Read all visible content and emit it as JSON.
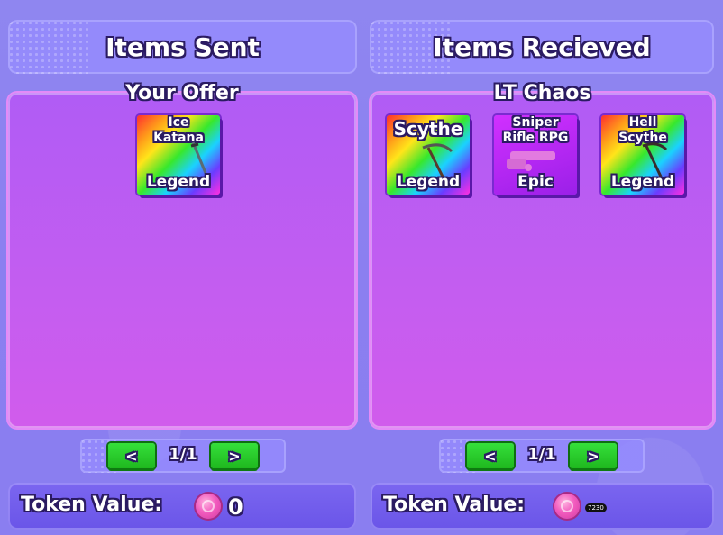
{
  "sent": {
    "header": "Items Sent",
    "box_title": "Your Offer",
    "items": [
      {
        "name": "Ice Katana",
        "rarity": "Legend",
        "icon": "katana-icon"
      }
    ],
    "pager": {
      "prev": "<",
      "next": ">",
      "count": "1/1"
    },
    "token": {
      "label": "Token Value:",
      "value": "0",
      "icon": "token-coin-icon"
    }
  },
  "received": {
    "header": "Items Recieved",
    "box_title": "LT Chaos",
    "items": [
      {
        "name": "Scythe",
        "rarity": "Legend",
        "icon": "scythe-icon"
      },
      {
        "name": "Sniper Rifle RPG",
        "rarity": "Epic",
        "icon": "rifle-icon"
      },
      {
        "name": "Hell Scythe",
        "rarity": "Legend",
        "icon": "hell-scythe-icon"
      }
    ],
    "pager": {
      "prev": "<",
      "next": ">",
      "count": "1/1"
    },
    "token": {
      "label": "Token Value:",
      "value": "7230",
      "icon": "token-coin-icon"
    }
  },
  "colors": {
    "legend_gradient": "rainbow",
    "epic": "#c02cf6",
    "button_green": "#2ccd2e",
    "panel_purple": "#c45df0"
  }
}
